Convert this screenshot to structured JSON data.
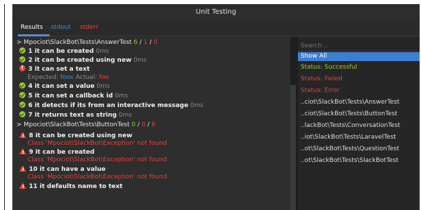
{
  "window": {
    "title": "Unit Testing"
  },
  "tabs": [
    {
      "label": "Results"
    },
    {
      "label": "stdout"
    },
    {
      "label": "stderr"
    }
  ],
  "colors": {
    "success": "#9acd32",
    "failure": "#e8473e",
    "link": "#3b8ed8",
    "selected": "#3d7fd1"
  },
  "results": {
    "groups": [
      {
        "name": "> Mpociot\\SlackBot\\Tests\\AnswerTest",
        "passed": "6",
        "failed": "1",
        "errors": "0",
        "sep": "/",
        "tests": [
          {
            "status": "passed",
            "icon": "check-circle-icon",
            "label": "1 it can be created",
            "time": "0ms"
          },
          {
            "status": "passed",
            "icon": "check-circle-icon",
            "label": "2 it can be created using new",
            "time": "0ms"
          },
          {
            "status": "failed",
            "icon": "exclamation-circle-icon",
            "label": "3 it can set a text",
            "time": "",
            "expected_label": "Expected:",
            "expected_value": "foox",
            "actual_label": "Actual:",
            "actual_value": "foo"
          },
          {
            "status": "passed",
            "icon": "check-circle-icon",
            "label": "4 it can set a value",
            "time": "0ms"
          },
          {
            "status": "passed",
            "icon": "check-circle-icon",
            "label": "5 it can set a callback id",
            "time": "0ms"
          },
          {
            "status": "passed",
            "icon": "check-circle-icon",
            "label": "6 it detects if its from an interactive message",
            "time": "0ms"
          },
          {
            "status": "passed",
            "icon": "check-circle-icon",
            "label": "7 it returns text as string",
            "time": "0ms"
          }
        ]
      },
      {
        "name": "> Mpociot\\SlackBot\\Tests\\ButtonTest",
        "passed": "0",
        "failed": "0",
        "errors": "6",
        "sep": "/",
        "tests": [
          {
            "status": "error",
            "icon": "warning-triangle-icon",
            "label": "8 it can be created using new",
            "message": "Class 'Mpociot\\SlackBot\\Exception' not found"
          },
          {
            "status": "error",
            "icon": "warning-triangle-icon",
            "label": "9 it can be created",
            "message": "Class 'Mpociot\\SlackBot\\Exception' not found"
          },
          {
            "status": "error",
            "icon": "warning-triangle-icon",
            "label": "10 it can have a value",
            "message": "Class 'Mpociot\\SlackBot\\Exception' not found"
          },
          {
            "status": "error",
            "icon": "warning-triangle-icon",
            "label": "11 it defaults name to text",
            "message": ""
          }
        ]
      }
    ]
  },
  "filter": {
    "search_placeholder": "Search ..",
    "items": [
      {
        "label": "Show All",
        "kind": "selected"
      },
      {
        "label": "Status: Successful",
        "kind": "success"
      },
      {
        "label": "Status: Failed",
        "kind": "failed"
      },
      {
        "label": "Status: Error",
        "kind": "error"
      },
      {
        "label": "..ciot\\SlackBot\\Tests\\AnswerTest",
        "kind": "path"
      },
      {
        "label": "..ciot\\SlackBot\\Tests\\ButtonTest",
        "kind": "path"
      },
      {
        "label": "..lackBot\\Tests\\ConversationTest",
        "kind": "path"
      },
      {
        "label": "..iot\\SlackBot\\Tests\\LaravelTest",
        "kind": "path"
      },
      {
        "label": "..ot\\SlackBot\\Tests\\QuestionTest",
        "kind": "path"
      },
      {
        "label": "..ot\\SlackBot\\Tests\\SlackBotTest",
        "kind": "path"
      }
    ]
  }
}
